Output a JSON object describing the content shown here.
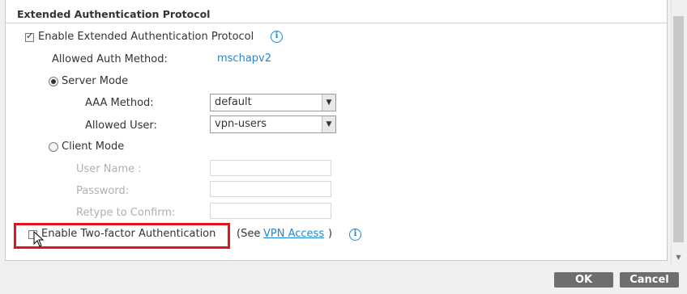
{
  "section": {
    "title": "Extended Authentication Protocol"
  },
  "enable_xauth": {
    "label": "Enable Extended Authentication Protocol",
    "checked": true
  },
  "allowed_auth_method": {
    "label": "Allowed Auth Method:",
    "value": "mschapv2"
  },
  "server_mode": {
    "label": "Server Mode",
    "selected": true,
    "aaa_method": {
      "label": "AAA Method:",
      "value": "default"
    },
    "allowed_user": {
      "label": "Allowed User:",
      "value": "vpn-users"
    }
  },
  "client_mode": {
    "label": "Client Mode",
    "selected": false,
    "user_name": {
      "label": "User Name :",
      "value": ""
    },
    "password": {
      "label": "Password:",
      "value": ""
    },
    "retype": {
      "label": "Retype to Confirm:",
      "value": ""
    }
  },
  "two_factor": {
    "label": "Enable Two-factor Authentication",
    "checked": false,
    "see_prefix": "(See ",
    "link": "VPN Access",
    "see_suffix": ")"
  },
  "buttons": {
    "ok": "OK",
    "cancel": "Cancel"
  },
  "colors": {
    "highlight": "#e0161c",
    "link": "#1e88d4",
    "button": "#6e6e6e"
  },
  "icons": [
    "info-icon",
    "checkbox-icon",
    "radio-icon",
    "chevron-down-icon",
    "mouse-cursor-icon"
  ]
}
